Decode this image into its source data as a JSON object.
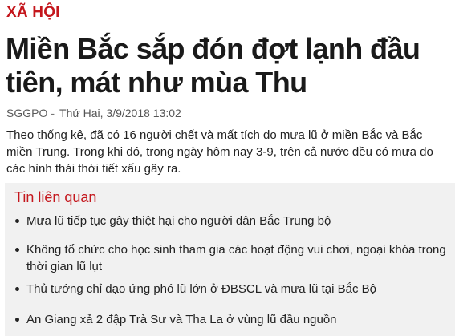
{
  "article": {
    "category": "XÃ HỘI",
    "title": "Miền Bắc sắp đón đợt lạnh đầu tiên, mát như mùa Thu",
    "source": "SGGPO",
    "separator": "-",
    "date": "Thứ Hai, 3/9/2018 13:02",
    "summary": "Theo thống kê, đã có 16 người chết và mất tích do mưa lũ ở miền Bắc và Bắc miền Trung. Trong khi đó, trong ngày hôm nay 3-9, trên cả nước đều có mưa do các hình thái thời tiết xấu gây ra."
  },
  "related": {
    "heading": "Tin liên quan",
    "items": [
      {
        "label": "Mưa lũ tiếp tục gây thiệt hại cho người dân Bắc Trung bộ"
      },
      {
        "label": "Không tổ chức cho học sinh tham gia các hoạt động vui chơi, ngoại khóa trong thời gian lũ lụt"
      },
      {
        "label": "Thủ tướng chỉ đạo ứng phó lũ lớn ở ĐBSCL và mưa lũ tại Bắc Bộ"
      },
      {
        "label": "An Giang xả 2 đập Trà Sư và Tha La ở vùng lũ đầu nguồn"
      }
    ]
  },
  "colors": {
    "accent": "#c4161c",
    "related_background": "#f1f1f1",
    "text": "#222222"
  }
}
